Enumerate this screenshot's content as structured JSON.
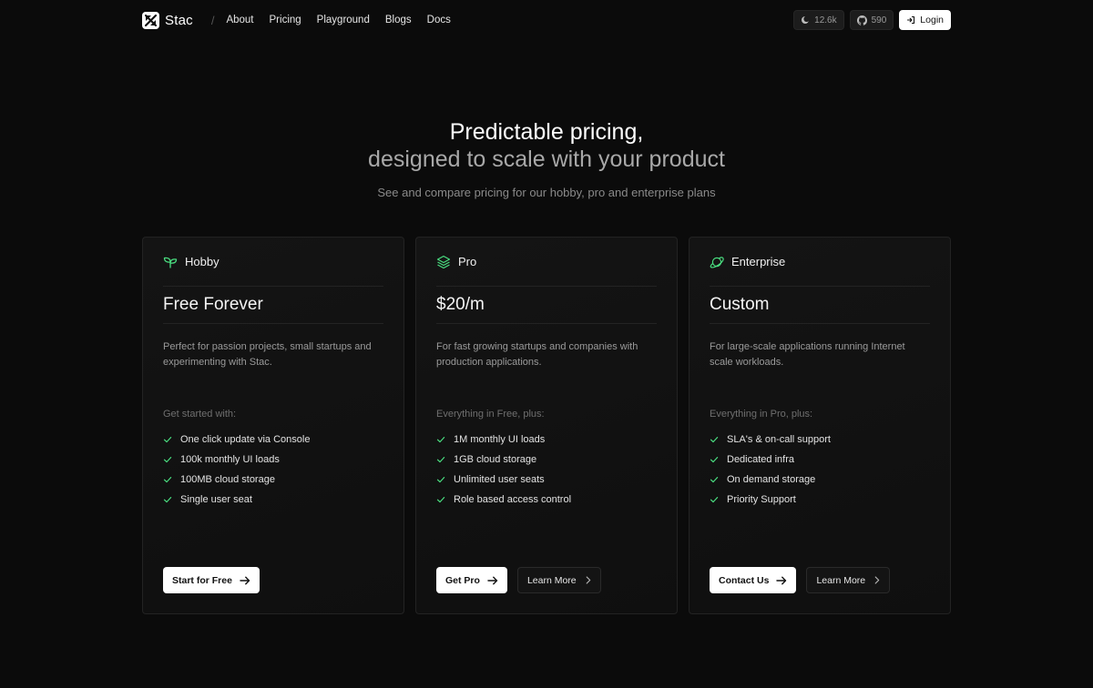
{
  "nav": {
    "brand": "Stac",
    "separator": "/",
    "links": [
      "About",
      "Pricing",
      "Playground",
      "Blogs",
      "Docs"
    ],
    "stats": [
      {
        "icon": "moon-icon",
        "value": "12.6k"
      },
      {
        "icon": "github-icon",
        "value": "590"
      }
    ],
    "login_label": "Login"
  },
  "hero": {
    "line1": "Predictable pricing,",
    "line2": "designed to scale with your product",
    "subtitle": "See and compare pricing for our hobby, pro and enterprise plans"
  },
  "accent_color": "#4ade80",
  "plans": [
    {
      "icon": "sprout-icon",
      "name": "Hobby",
      "price": "Free Forever",
      "description": "Perfect for passion projects, small startups and experimenting with Stac.",
      "lead": "Get started with:",
      "features": [
        "One click update via Console",
        "100k monthly UI loads",
        "100MB cloud storage",
        "Single user seat"
      ],
      "primary_label": "Start for Free",
      "secondary_label": null
    },
    {
      "icon": "layers-icon",
      "name": "Pro",
      "price": "$20/m",
      "description": "For fast growing startups and companies with production applications.",
      "lead": "Everything in Free, plus:",
      "features": [
        "1M monthly UI loads",
        "1GB cloud storage",
        "Unlimited user seats",
        "Role based access control"
      ],
      "primary_label": "Get Pro",
      "secondary_label": "Learn More"
    },
    {
      "icon": "planet-icon",
      "name": "Enterprise",
      "price": "Custom",
      "description": "For large-scale applications running Internet scale workloads.",
      "lead": "Everything in Pro, plus:",
      "features": [
        "SLA's & on-call support",
        "Dedicated infra",
        "On demand storage",
        "Priority Support"
      ],
      "primary_label": "Contact Us",
      "secondary_label": "Learn More"
    }
  ]
}
